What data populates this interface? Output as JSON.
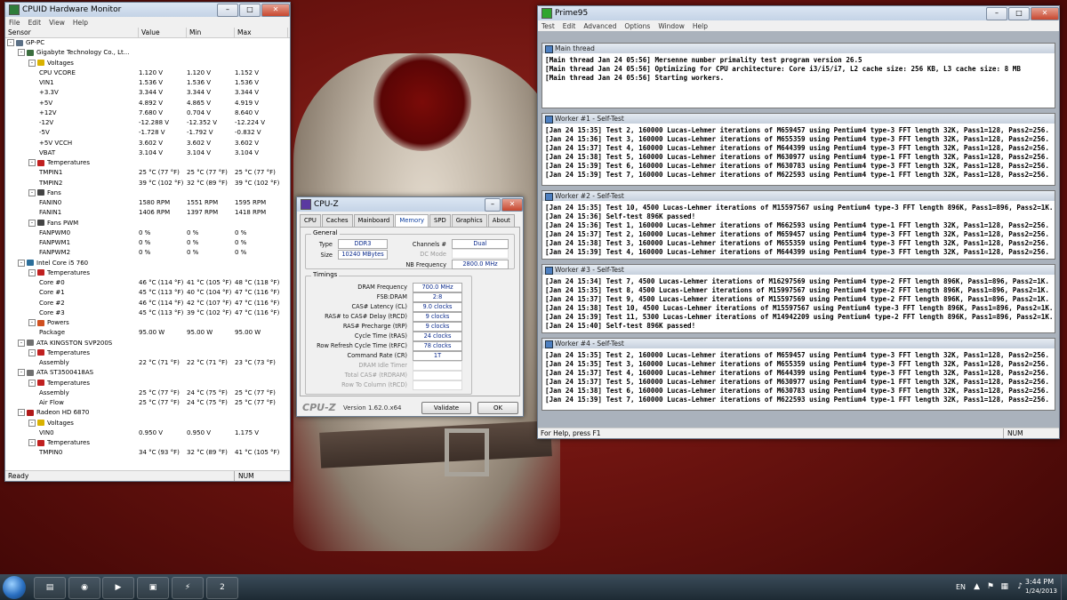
{
  "hwmonitor": {
    "title": "CPUID Hardware Monitor",
    "menu": [
      "File",
      "Edit",
      "View",
      "Help"
    ],
    "columns": [
      "Sensor",
      "Value",
      "Min",
      "Max"
    ],
    "status": "Ready",
    "status_num": "NUM",
    "rows": [
      {
        "level": 0,
        "label": "GP-PC",
        "icon": "computer-icon",
        "toggle": "-",
        "value": "",
        "min": "",
        "max": ""
      },
      {
        "level": 1,
        "label": "Gigabyte Technology Co., Lt...",
        "icon": "motherboard-icon",
        "toggle": "-",
        "value": "",
        "min": "",
        "max": ""
      },
      {
        "level": 2,
        "label": "Voltages",
        "icon": "voltage-icon",
        "toggle": "-",
        "value": "",
        "min": "",
        "max": ""
      },
      {
        "level": 3,
        "label": "CPU VCORE",
        "icon": "",
        "toggle": "",
        "value": "1.120 V",
        "min": "1.120 V",
        "max": "1.152 V"
      },
      {
        "level": 3,
        "label": "VIN1",
        "icon": "",
        "toggle": "",
        "value": "1.536 V",
        "min": "1.536 V",
        "max": "1.536 V"
      },
      {
        "level": 3,
        "label": "+3.3V",
        "icon": "",
        "toggle": "",
        "value": "3.344 V",
        "min": "3.344 V",
        "max": "3.344 V"
      },
      {
        "level": 3,
        "label": "+5V",
        "icon": "",
        "toggle": "",
        "value": "4.892 V",
        "min": "4.865 V",
        "max": "4.919 V"
      },
      {
        "level": 3,
        "label": "+12V",
        "icon": "",
        "toggle": "",
        "value": "7.680 V",
        "min": "0.704 V",
        "max": "8.640 V"
      },
      {
        "level": 3,
        "label": "-12V",
        "icon": "",
        "toggle": "",
        "value": "-12.288 V",
        "min": "-12.352 V",
        "max": "-12.224 V"
      },
      {
        "level": 3,
        "label": "-5V",
        "icon": "",
        "toggle": "",
        "value": "-1.728 V",
        "min": "-1.792 V",
        "max": "-0.832 V"
      },
      {
        "level": 3,
        "label": "+5V VCCH",
        "icon": "",
        "toggle": "",
        "value": "3.602 V",
        "min": "3.602 V",
        "max": "3.602 V"
      },
      {
        "level": 3,
        "label": "VBAT",
        "icon": "",
        "toggle": "",
        "value": "3.104 V",
        "min": "3.104 V",
        "max": "3.104 V"
      },
      {
        "level": 2,
        "label": "Temperatures",
        "icon": "thermometer-icon",
        "toggle": "-",
        "value": "",
        "min": "",
        "max": ""
      },
      {
        "level": 3,
        "label": "TMPIN1",
        "icon": "",
        "toggle": "",
        "value": "25 °C (77 °F)",
        "min": "25 °C (77 °F)",
        "max": "25 °C (77 °F)"
      },
      {
        "level": 3,
        "label": "TMPIN2",
        "icon": "",
        "toggle": "",
        "value": "39 °C (102 °F)",
        "min": "32 °C (89 °F)",
        "max": "39 °C (102 °F)"
      },
      {
        "level": 2,
        "label": "Fans",
        "icon": "fan-icon",
        "toggle": "-",
        "value": "",
        "min": "",
        "max": ""
      },
      {
        "level": 3,
        "label": "FANIN0",
        "icon": "",
        "toggle": "",
        "value": "1580 RPM",
        "min": "1551 RPM",
        "max": "1595 RPM"
      },
      {
        "level": 3,
        "label": "FANIN1",
        "icon": "",
        "toggle": "",
        "value": "1406 RPM",
        "min": "1397 RPM",
        "max": "1418 RPM"
      },
      {
        "level": 2,
        "label": "Fans PWM",
        "icon": "fan-icon",
        "toggle": "-",
        "value": "",
        "min": "",
        "max": ""
      },
      {
        "level": 3,
        "label": "FANPWM0",
        "icon": "",
        "toggle": "",
        "value": "0 %",
        "min": "0 %",
        "max": "0 %"
      },
      {
        "level": 3,
        "label": "FANPWM1",
        "icon": "",
        "toggle": "",
        "value": "0 %",
        "min": "0 %",
        "max": "0 %"
      },
      {
        "level": 3,
        "label": "FANPWM2",
        "icon": "",
        "toggle": "",
        "value": "0 %",
        "min": "0 %",
        "max": "0 %"
      },
      {
        "level": 1,
        "label": "Intel Core i5 760",
        "icon": "cpu-icon",
        "toggle": "-",
        "value": "",
        "min": "",
        "max": ""
      },
      {
        "level": 2,
        "label": "Temperatures",
        "icon": "thermometer-icon",
        "toggle": "-",
        "value": "",
        "min": "",
        "max": ""
      },
      {
        "level": 3,
        "label": "Core #0",
        "icon": "",
        "toggle": "",
        "value": "46 °C (114 °F)",
        "min": "41 °C (105 °F)",
        "max": "48 °C (118 °F)"
      },
      {
        "level": 3,
        "label": "Core #1",
        "icon": "",
        "toggle": "",
        "value": "45 °C (113 °F)",
        "min": "40 °C (104 °F)",
        "max": "47 °C (116 °F)"
      },
      {
        "level": 3,
        "label": "Core #2",
        "icon": "",
        "toggle": "",
        "value": "46 °C (114 °F)",
        "min": "42 °C (107 °F)",
        "max": "47 °C (116 °F)"
      },
      {
        "level": 3,
        "label": "Core #3",
        "icon": "",
        "toggle": "",
        "value": "45 °C (113 °F)",
        "min": "39 °C (102 °F)",
        "max": "47 °C (116 °F)"
      },
      {
        "level": 2,
        "label": "Powers",
        "icon": "power-icon",
        "toggle": "-",
        "value": "",
        "min": "",
        "max": ""
      },
      {
        "level": 3,
        "label": "Package",
        "icon": "",
        "toggle": "",
        "value": "95.00 W",
        "min": "95.00 W",
        "max": "95.00 W"
      },
      {
        "level": 1,
        "label": "ATA KINGSTON SVP200S",
        "icon": "disk-icon",
        "toggle": "-",
        "value": "",
        "min": "",
        "max": ""
      },
      {
        "level": 2,
        "label": "Temperatures",
        "icon": "thermometer-icon",
        "toggle": "-",
        "value": "",
        "min": "",
        "max": ""
      },
      {
        "level": 3,
        "label": "Assembly",
        "icon": "",
        "toggle": "",
        "value": "22 °C (71 °F)",
        "min": "22 °C (71 °F)",
        "max": "23 °C (73 °F)"
      },
      {
        "level": 1,
        "label": "ATA ST3500418AS",
        "icon": "disk-icon",
        "toggle": "-",
        "value": "",
        "min": "",
        "max": ""
      },
      {
        "level": 2,
        "label": "Temperatures",
        "icon": "thermometer-icon",
        "toggle": "-",
        "value": "",
        "min": "",
        "max": ""
      },
      {
        "level": 3,
        "label": "Assembly",
        "icon": "",
        "toggle": "",
        "value": "25 °C (77 °F)",
        "min": "24 °C (75 °F)",
        "max": "25 °C (77 °F)"
      },
      {
        "level": 3,
        "label": "Air Flow",
        "icon": "",
        "toggle": "",
        "value": "25 °C (77 °F)",
        "min": "24 °C (75 °F)",
        "max": "25 °C (77 °F)"
      },
      {
        "level": 1,
        "label": "Radeon HD 6870",
        "icon": "gpu-icon",
        "toggle": "-",
        "value": "",
        "min": "",
        "max": ""
      },
      {
        "level": 2,
        "label": "Voltages",
        "icon": "voltage-icon",
        "toggle": "-",
        "value": "",
        "min": "",
        "max": ""
      },
      {
        "level": 3,
        "label": "VIN0",
        "icon": "",
        "toggle": "",
        "value": "0.950 V",
        "min": "0.950 V",
        "max": "1.175 V"
      },
      {
        "level": 2,
        "label": "Temperatures",
        "icon": "thermometer-icon",
        "toggle": "-",
        "value": "",
        "min": "",
        "max": ""
      },
      {
        "level": 3,
        "label": "TMPIN0",
        "icon": "",
        "toggle": "",
        "value": "34 °C (93 °F)",
        "min": "32 °C (89 °F)",
        "max": "41 °C (105 °F)"
      }
    ]
  },
  "prime95": {
    "title": "Prime95",
    "menu": [
      "Test",
      "Edit",
      "Advanced",
      "Options",
      "Window",
      "Help"
    ],
    "status": "For Help, press F1",
    "status_num": "NUM",
    "panels": [
      {
        "title": "Main thread",
        "lines": [
          "[Main thread Jan 24 05:56] Mersenne number primality test program version 26.5",
          "[Main thread Jan 24 05:56] Optimizing for CPU architecture: Core i3/i5/i7, L2 cache size: 256 KB, L3 cache size: 8 MB",
          "[Main thread Jan 24 05:56] Starting workers."
        ]
      },
      {
        "title": "Worker #1 - Self-Test",
        "lines": [
          "[Jan 24 15:35] Test 2, 160000 Lucas-Lehmer iterations of M659457 using Pentium4 type-3 FFT length 32K, Pass1=128, Pass2=256.",
          "[Jan 24 15:36] Test 3, 160000 Lucas-Lehmer iterations of M655359 using Pentium4 type-3 FFT length 32K, Pass1=128, Pass2=256.",
          "[Jan 24 15:37] Test 4, 160000 Lucas-Lehmer iterations of M644399 using Pentium4 type-3 FFT length 32K, Pass1=128, Pass2=256.",
          "[Jan 24 15:38] Test 5, 160000 Lucas-Lehmer iterations of M630977 using Pentium4 type-1 FFT length 32K, Pass1=128, Pass2=256.",
          "[Jan 24 15:39] Test 6, 160000 Lucas-Lehmer iterations of M630783 using Pentium4 type-3 FFT length 32K, Pass1=128, Pass2=256.",
          "[Jan 24 15:39] Test 7, 160000 Lucas-Lehmer iterations of M622593 using Pentium4 type-1 FFT length 32K, Pass1=128, Pass2=256."
        ]
      },
      {
        "title": "Worker #2 - Self-Test",
        "lines": [
          "[Jan 24 15:35] Test 10, 4500 Lucas-Lehmer iterations of M15597567 using Pentium4 type-3 FFT length 896K, Pass1=896, Pass2=1K.",
          "[Jan 24 15:36] Self-test 896K passed!",
          "[Jan 24 15:36] Test 1, 160000 Lucas-Lehmer iterations of M662593 using Pentium4 type-1 FFT length 32K, Pass1=128, Pass2=256.",
          "[Jan 24 15:37] Test 2, 160000 Lucas-Lehmer iterations of M659457 using Pentium4 type-3 FFT length 32K, Pass1=128, Pass2=256.",
          "[Jan 24 15:38] Test 3, 160000 Lucas-Lehmer iterations of M655359 using Pentium4 type-3 FFT length 32K, Pass1=128, Pass2=256.",
          "[Jan 24 15:39] Test 4, 160000 Lucas-Lehmer iterations of M644399 using Pentium4 type-3 FFT length 32K, Pass1=128, Pass2=256."
        ]
      },
      {
        "title": "Worker #3 - Self-Test",
        "lines": [
          "[Jan 24 15:34] Test 7, 4500 Lucas-Lehmer iterations of M16297569 using Pentium4 type-2 FFT length 896K, Pass1=896, Pass2=1K.",
          "[Jan 24 15:35] Test 8, 4500 Lucas-Lehmer iterations of M15997567 using Pentium4 type-2 FFT length 896K, Pass1=896, Pass2=1K.",
          "[Jan 24 15:37] Test 9, 4500 Lucas-Lehmer iterations of M15597569 using Pentium4 type-2 FFT length 896K, Pass1=896, Pass2=1K.",
          "[Jan 24 15:38] Test 10, 4500 Lucas-Lehmer iterations of M15597567 using Pentium4 type-3 FFT length 896K, Pass1=896, Pass2=1K.",
          "[Jan 24 15:39] Test 11, 5300 Lucas-Lehmer iterations of M14942209 using Pentium4 type-2 FFT length 896K, Pass1=896, Pass2=1K.",
          "[Jan 24 15:40] Self-test 896K passed!"
        ]
      },
      {
        "title": "Worker #4 - Self-Test",
        "lines": [
          "[Jan 24 15:35] Test 2, 160000 Lucas-Lehmer iterations of M659457 using Pentium4 type-3 FFT length 32K, Pass1=128, Pass2=256.",
          "[Jan 24 15:35] Test 3, 160000 Lucas-Lehmer iterations of M655359 using Pentium4 type-3 FFT length 32K, Pass1=128, Pass2=256.",
          "[Jan 24 15:37] Test 4, 160000 Lucas-Lehmer iterations of M644399 using Pentium4 type-3 FFT length 32K, Pass1=128, Pass2=256.",
          "[Jan 24 15:37] Test 5, 160000 Lucas-Lehmer iterations of M630977 using Pentium4 type-1 FFT length 32K, Pass1=128, Pass2=256.",
          "[Jan 24 15:38] Test 6, 160000 Lucas-Lehmer iterations of M630783 using Pentium4 type-3 FFT length 32K, Pass1=128, Pass2=256.",
          "[Jan 24 15:39] Test 7, 160000 Lucas-Lehmer iterations of M622593 using Pentium4 type-1 FFT length 32K, Pass1=128, Pass2=256."
        ]
      }
    ]
  },
  "cpuz": {
    "title": "CPU-Z",
    "tabs": [
      "CPU",
      "Caches",
      "Mainboard",
      "Memory",
      "SPD",
      "Graphics",
      "About"
    ],
    "active_tab": "Memory",
    "general_label": "General",
    "type_label": "Type",
    "type_value": "DDR3",
    "size_label": "Size",
    "size_value": "10240 MBytes",
    "channels_label": "Channels #",
    "channels_value": "Dual",
    "dcmode_label": "DC Mode",
    "dcmode_value": "",
    "nbfreq_label": "NB Frequency",
    "nbfreq_value": "2800.0 MHz",
    "timings_label": "Timings",
    "timings": [
      {
        "label": "DRAM Frequency",
        "value": "700.0 MHz",
        "dim": false
      },
      {
        "label": "FSB:DRAM",
        "value": "2:8",
        "dim": false
      },
      {
        "label": "CAS# Latency (CL)",
        "value": "9.0 clocks",
        "dim": false
      },
      {
        "label": "RAS# to CAS# Delay (tRCD)",
        "value": "9 clocks",
        "dim": false
      },
      {
        "label": "RAS# Precharge (tRP)",
        "value": "9 clocks",
        "dim": false
      },
      {
        "label": "Cycle Time (tRAS)",
        "value": "24 clocks",
        "dim": false
      },
      {
        "label": "Row Refresh Cycle Time (tRFC)",
        "value": "78 clocks",
        "dim": false
      },
      {
        "label": "Command Rate (CR)",
        "value": "1T",
        "dim": false
      },
      {
        "label": "DRAM Idle Timer",
        "value": "",
        "dim": true
      },
      {
        "label": "Total CAS# (tRDRAM)",
        "value": "",
        "dim": true
      },
      {
        "label": "Row To Column (tRCD)",
        "value": "",
        "dim": true
      }
    ],
    "logo": "CPU-Z",
    "version": "Version 1.62.0.x64",
    "validate_label": "Validate",
    "ok_label": "OK"
  },
  "taskbar": {
    "language": "EN",
    "time": "3:44 PM",
    "date": "1/24/2013",
    "apps": [
      {
        "name": "explorer-icon",
        "glyph": "▤"
      },
      {
        "name": "chrome-icon",
        "glyph": "◉"
      },
      {
        "name": "media-player-icon",
        "glyph": "▶"
      },
      {
        "name": "cpuz-icon",
        "glyph": "▣"
      },
      {
        "name": "hwmonitor-icon",
        "glyph": "⚡"
      },
      {
        "name": "prime95-icon",
        "glyph": "2"
      }
    ]
  },
  "colors": {
    "desktop_red": "#6e1410",
    "cpuz_blue": "#0a2a8c",
    "hwm_thermo_red": "#c02020",
    "prime_icon_green": "#2fa52f"
  }
}
